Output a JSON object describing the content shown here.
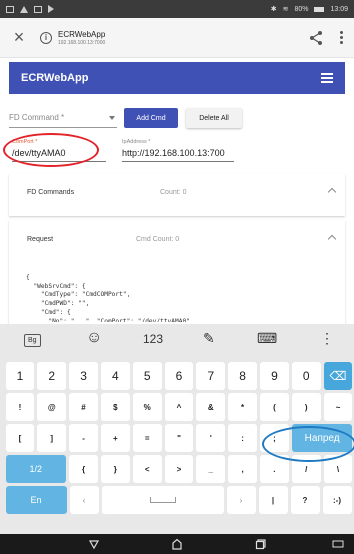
{
  "status_bar": {
    "battery_percent": "80%",
    "time": "13:09"
  },
  "browser": {
    "title": "ECRWebApp",
    "host": "192.168.100.13:7000"
  },
  "app_bar": {
    "title": "ECRWebApp"
  },
  "command_row": {
    "fd_command_placeholder": "FD Command *",
    "add_button": "Add Cmd",
    "delete_button": "Delete All"
  },
  "fields": {
    "comport_label": "ComPort *",
    "comport_value": "/dev/ttyAMA0",
    "ip_label": "IpAddress *",
    "ip_value": "http://192.168.100.13:700"
  },
  "panels": {
    "fd_commands": {
      "title": "FD Commands",
      "count": "Count: 0"
    },
    "request": {
      "title": "Request",
      "count": "Cmd Count: 0"
    }
  },
  "code_lines": [
    "{",
    "  \"WebSrvCmd\": {",
    "    \"CmdType\": \"CmdCOMPort\",",
    "    \"CmdPWD\": \"\",",
    "    \"Cmd\": {",
    "      \"No\": \"...\"  \"ComPort\": \"/dev/ttyAMA0\""
  ],
  "keyboard": {
    "top_bar": {
      "lang": "Bg",
      "emoji": "☺",
      "numbers": "123",
      "palette": "✎",
      "keyboard": "⌨",
      "more": "⋮"
    },
    "row1": [
      "1",
      "2",
      "3",
      "4",
      "5",
      "6",
      "7",
      "8",
      "9",
      "0",
      "⌫"
    ],
    "row2": [
      "!",
      "@",
      "#",
      "$",
      "%",
      "^",
      "&",
      "*",
      "(",
      ")",
      "~"
    ],
    "row3": [
      "[",
      "]",
      "-",
      "+",
      "=",
      "\"",
      "'",
      ":",
      ";",
      "Напред"
    ],
    "row4": [
      "1/2",
      "{",
      "}",
      "<",
      ">",
      "_",
      ",",
      ".",
      "/",
      "\\"
    ],
    "row5": [
      "En",
      "‹",
      "",
      "›",
      "|",
      "?",
      ":-)"
    ]
  },
  "colors": {
    "primary": "#3f51b5",
    "key_blue": "#47a6db",
    "annotation_red": "#e3232a",
    "annotation_blue": "#1e7ac2"
  }
}
